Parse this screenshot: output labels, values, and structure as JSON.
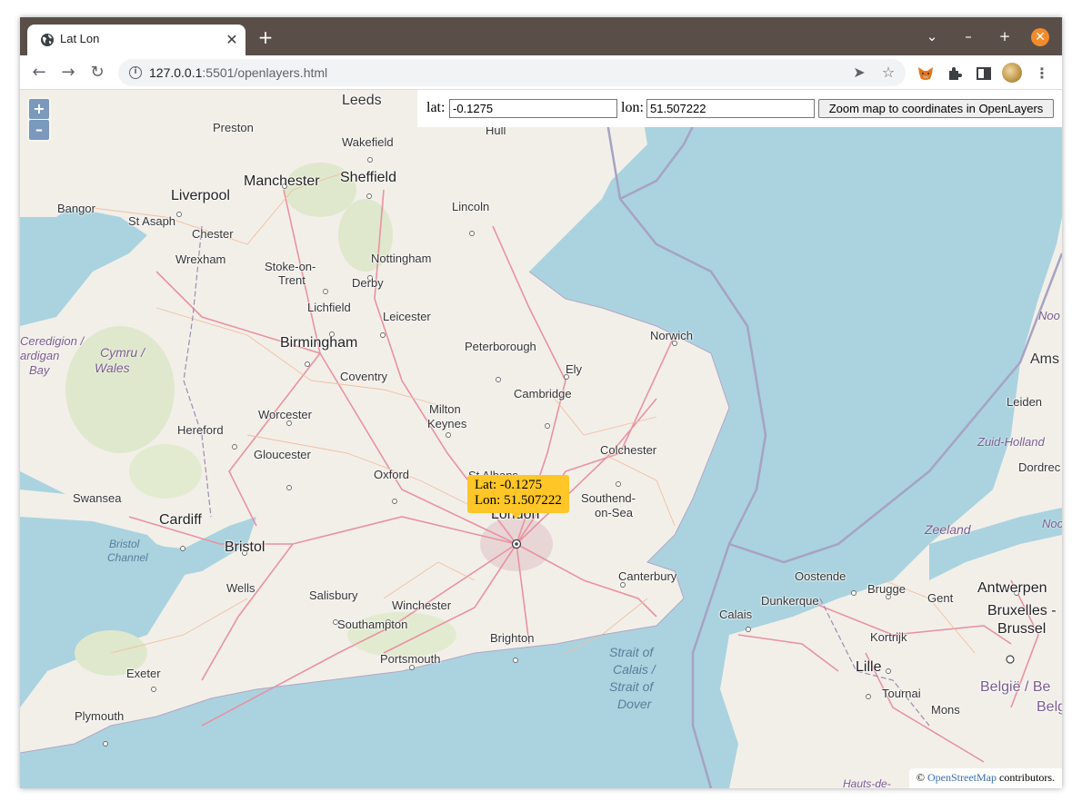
{
  "browser": {
    "tab_title": "Lat Lon",
    "url_host": "127.0.0.1",
    "url_rest": ":5501/openlayers.html"
  },
  "form": {
    "lat_label": "lat:",
    "lat_value": "-0.1275",
    "lon_label": "lon:",
    "lon_value": "51.507222",
    "zoom_button": "Zoom map to coordinates in OpenLayers"
  },
  "zoom": {
    "in": "+",
    "out": "–"
  },
  "popup": {
    "lat_line": "Lat: -0.1275",
    "lon_line": "Lon: 51.507222"
  },
  "attribution": {
    "prefix": "©",
    "link": "OpenStreetMap",
    "suffix": "contributors."
  },
  "map_labels": {
    "leeds": "Leeds",
    "preston": "Preston",
    "wakefield": "Wakefield",
    "hull": "Hull",
    "manchester": "Manchester",
    "sheffield": "Sheffield",
    "liverpool": "Liverpool",
    "bangor": "Bangor",
    "st_asaph": "St Asaph",
    "lincoln": "Lincoln",
    "chester": "Chester",
    "wrexham": "Wrexham",
    "nottingham": "Nottingham",
    "stoke1": "Stoke-on-",
    "stoke2": "Trent",
    "derby": "Derby",
    "lichfield": "Lichfield",
    "leicester": "Leicester",
    "norwich": "Norwich",
    "ceredigion1": "Ceredigion /",
    "ceredigion2": "ardigan",
    "ceredigion3": "Bay",
    "cymru1": "Cymru /",
    "cymru2": "Wales",
    "birmingham": "Birmingham",
    "peterborough": "Peterborough",
    "coventry": "Coventry",
    "ely": "Ely",
    "noord": "Noo",
    "amsterdam": "Ams",
    "cambridge": "Cambridge",
    "milton1": "Milton",
    "milton2": "Keynes",
    "worcester": "Worcester",
    "leiden": "Leiden",
    "hereford": "Hereford",
    "zuid_holland": "Zuid-Holland",
    "colchester": "Colchester",
    "gloucester": "Gloucester",
    "oxford": "Oxford",
    "st_albans": "St Albans",
    "dordrecht": "Dordrec",
    "swansea": "Swansea",
    "southend1": "Southend-",
    "southend2": "on-Sea",
    "cardiff": "Cardiff",
    "london": "London",
    "zeeland": "Zeeland",
    "noord2": "Noo",
    "bristol": "Bristol",
    "bristol_channel1": "Bristol",
    "bristol_channel2": "Channel",
    "oostende": "Oostende",
    "antwerpen": "Antwerpen",
    "canterbury": "Canterbury",
    "wells": "Wells",
    "salisbury": "Salisbury",
    "brugge": "Brugge",
    "gent": "Gent",
    "bruxelles1": "Bruxelles -",
    "bruxelles2": "Brussel",
    "dunkerque": "Dunkerque",
    "winchester": "Winchester",
    "calais": "Calais",
    "southampton": "Southampton",
    "kortrijk": "Kortrijk",
    "brighton": "Brighton",
    "strait1": "Strait of",
    "strait2": "Calais /",
    "strait3": "Strait of",
    "strait4": "Dover",
    "portsmouth": "Portsmouth",
    "lille": "Lille",
    "belgie1": "België / Be",
    "belgie2": "Belgi",
    "exeter": "Exeter",
    "tournai": "Tournai",
    "mons": "Mons",
    "plymouth": "Plymouth",
    "hauts": "Hauts-de-"
  },
  "colors": {
    "sea": "#aad3df",
    "land": "#f2efe9",
    "popup": "#ffc628",
    "titlebar": "#5a4f48"
  }
}
